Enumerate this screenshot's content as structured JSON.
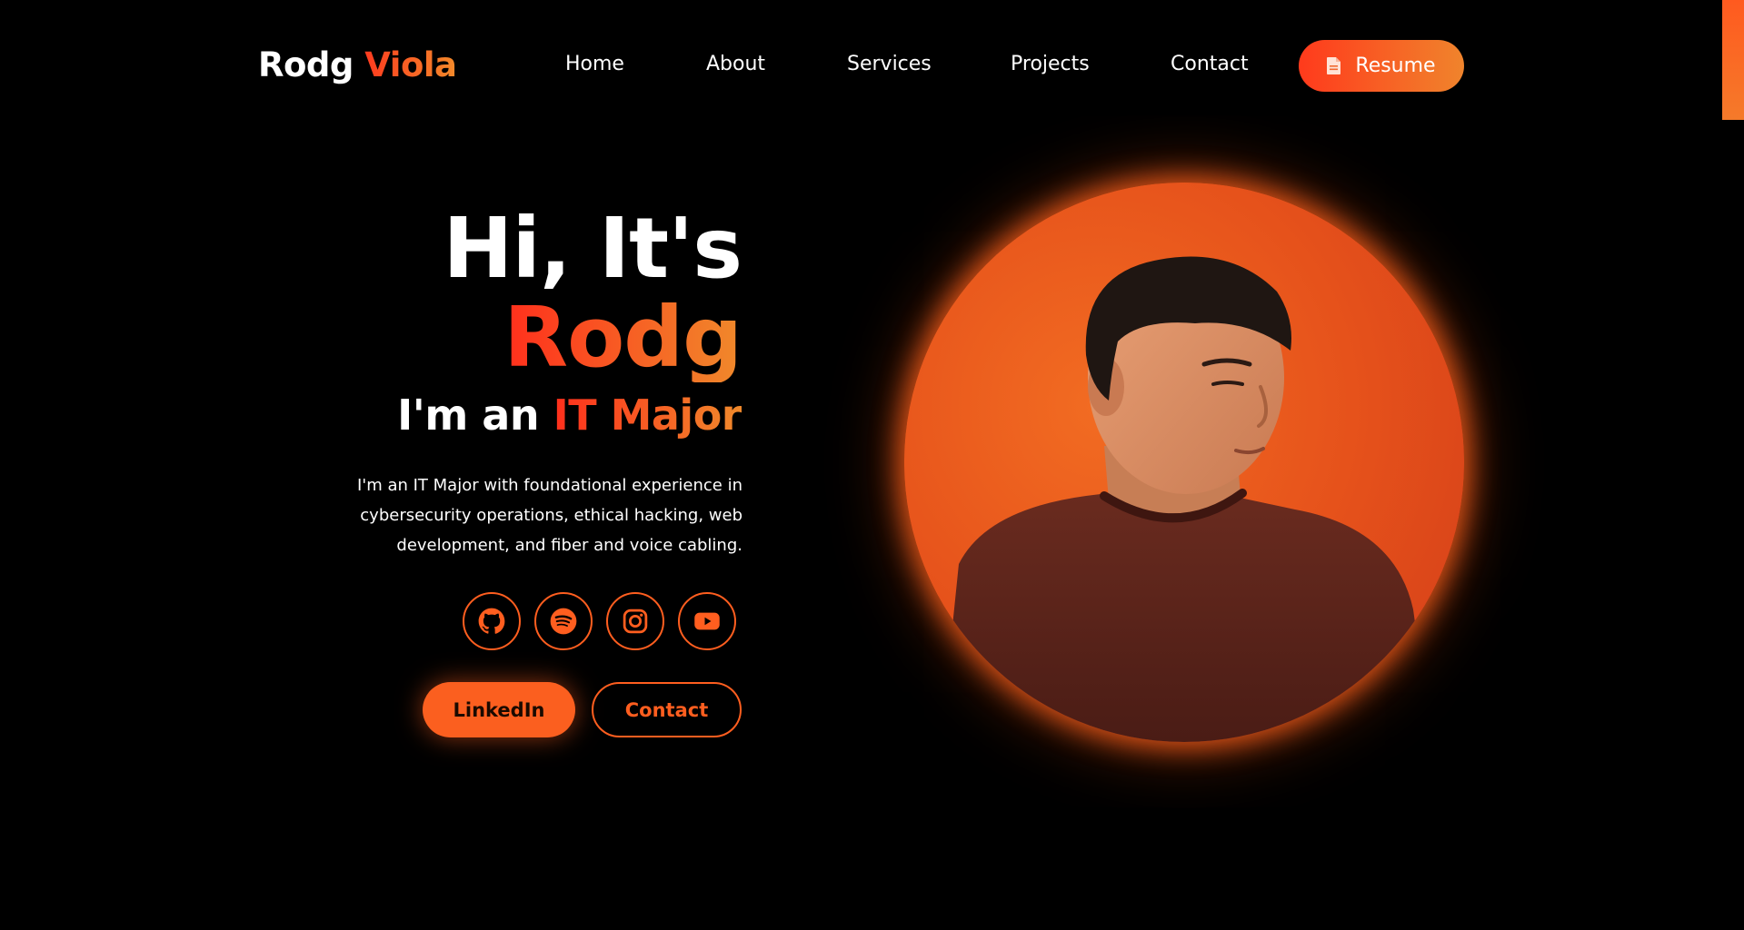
{
  "brand": {
    "first": "Rodg",
    "last": "Viola"
  },
  "nav": {
    "items": [
      {
        "label": "Home"
      },
      {
        "label": "About"
      },
      {
        "label": "Services"
      },
      {
        "label": "Projects"
      },
      {
        "label": "Contact"
      }
    ],
    "resume_label": "Resume",
    "resume_icon": "document-icon"
  },
  "hero": {
    "greeting": "Hi, It's",
    "name": "Rodg",
    "role_prefix": "I'm an",
    "role_accent": "IT Major",
    "bio": "I'm an IT Major with foundational experience in cybersecurity operations, ethical hacking, web development, and fiber and voice cabling."
  },
  "socials": [
    {
      "icon": "github-icon"
    },
    {
      "icon": "spotify-icon"
    },
    {
      "icon": "instagram-icon"
    },
    {
      "icon": "youtube-icon"
    }
  ],
  "cta": {
    "primary_label": "LinkedIn",
    "secondary_label": "Contact"
  },
  "colors": {
    "accent": "#ff5e1f",
    "gradient_start": "#ff2f1c",
    "gradient_end": "#f0892b",
    "background": "#000000",
    "text": "#ffffff"
  }
}
